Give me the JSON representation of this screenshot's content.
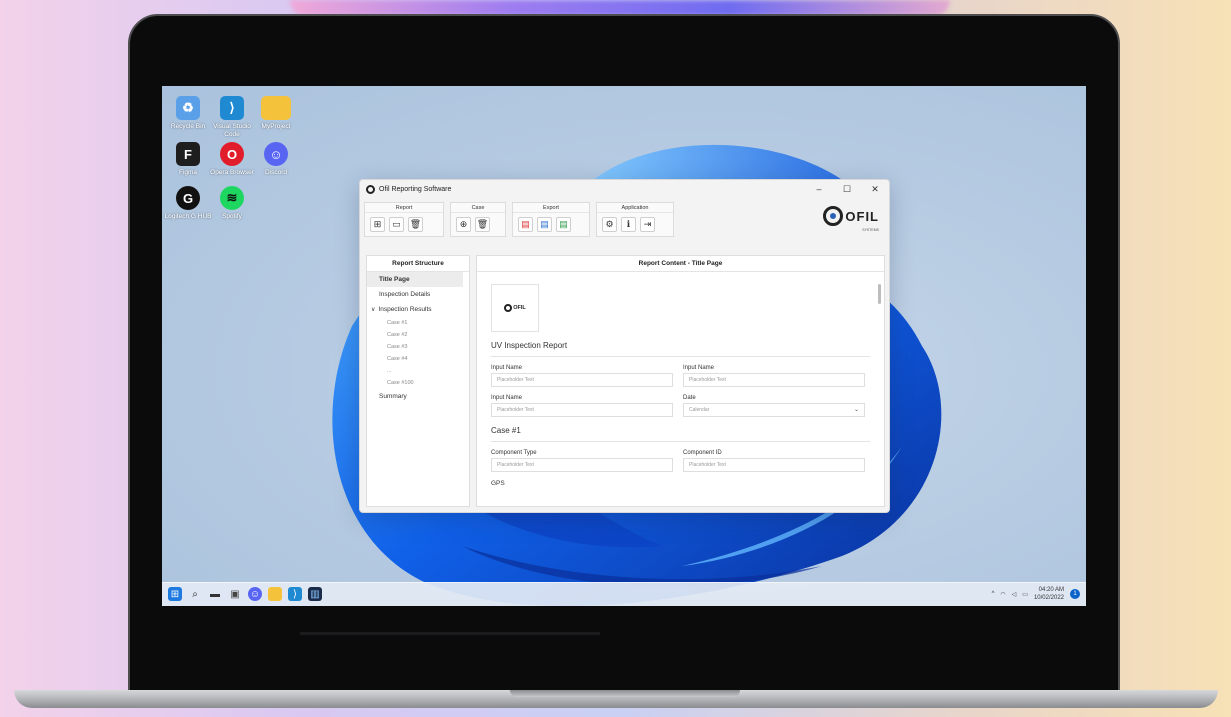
{
  "desktop_icons": [
    {
      "name": "recycle-bin-icon",
      "label": "Recycle Bin",
      "color": "#5aa0e8",
      "glyph": "♻"
    },
    {
      "name": "vscode-icon",
      "label": "Visual Studio Code",
      "color": "#1f8ad2",
      "glyph": "⟩"
    },
    {
      "name": "folder-icon",
      "label": "MyProject",
      "color": "#f5c33b",
      "glyph": ""
    },
    {
      "name": "figma-icon",
      "label": "Figma",
      "color": "#1e1e1e",
      "glyph": "F"
    },
    {
      "name": "opera-icon",
      "label": "Opera Browser",
      "color": "#e21d2b",
      "glyph": "O"
    },
    {
      "name": "discord-icon",
      "label": "Discord",
      "color": "#5865f2",
      "glyph": "☺"
    },
    {
      "name": "logitech-icon",
      "label": "Logitech G HUB",
      "color": "#111111",
      "glyph": "G"
    },
    {
      "name": "spotify-icon",
      "label": "Spotify",
      "color": "#1ed760",
      "glyph": "≋"
    }
  ],
  "window": {
    "title": "Ofil Reporting Software",
    "minimize": "–",
    "maximize": "☐",
    "close": "✕"
  },
  "ribbon": {
    "groups": [
      {
        "title": "Report",
        "buttons": [
          "new-report",
          "open-report",
          "delete-report"
        ]
      },
      {
        "title": "Case",
        "buttons": [
          "add-case",
          "delete-case"
        ]
      },
      {
        "title": "Export",
        "buttons": [
          "export-pdf",
          "export-word",
          "export-excel"
        ]
      },
      {
        "title": "Application",
        "buttons": [
          "settings",
          "info",
          "exit"
        ]
      }
    ],
    "logo_text": "OFIL",
    "logo_sub": "SYSTEMS"
  },
  "left_panel": {
    "heading": "Report Structure",
    "items": {
      "title_page": "Title Page",
      "inspection_details": "Inspection Details",
      "inspection_results": "Inspection Results",
      "case1": "Case #1",
      "case2": "Case #2",
      "case3": "Case #3",
      "case4": "Case #4",
      "ellipsis": "...",
      "case100": "Case #100",
      "summary": "Summary"
    }
  },
  "right_panel": {
    "heading": "Report Content - Title Page",
    "mini_logo": "OFIL",
    "section1": "UV Inspection Report",
    "fields": {
      "f1_label": "Input Name",
      "f1_placeholder": "Placeholder Text",
      "f2_label": "Input Name",
      "f2_placeholder": "Placeholder Text",
      "f3_label": "Input Name",
      "f3_placeholder": "Placeholder Text",
      "f4_label": "Date",
      "f4_value": "Calendar"
    },
    "section2": "Case #1",
    "case_fields": {
      "c1_label": "Component Type",
      "c1_placeholder": "Placeholder Text",
      "c2_label": "Component ID",
      "c2_placeholder": "Placeholder Text"
    },
    "gps": "GPS"
  },
  "taskbar": {
    "time": "04:20 AM",
    "date": "10/02/2022",
    "notification_count": "1"
  }
}
